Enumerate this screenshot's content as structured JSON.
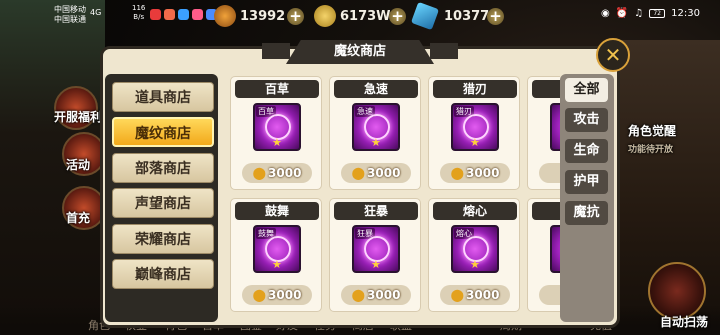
{
  "status_bar": {
    "carrier1": "中国移动",
    "carrier2": "中国联通",
    "network": "4G",
    "speed_value": "116",
    "speed_unit": "B/s",
    "battery": "72",
    "time": "12:30"
  },
  "currencies": [
    {
      "name": "energy",
      "value": "13992"
    },
    {
      "name": "gold",
      "value": "6173W"
    },
    {
      "name": "crystal",
      "value": "10377"
    }
  ],
  "background": {
    "left_items": [
      "开服福利",
      "活动",
      "首充"
    ],
    "right_items": [
      "角色觉醒",
      "功能待开放"
    ],
    "bottom_items": [
      "角色",
      "秩业",
      "背包",
      "百草",
      "图鉴",
      "好友",
      "任务",
      "商店",
      "联盟",
      "周期",
      "充值"
    ],
    "auto_sweep": "自动扫荡"
  },
  "shop": {
    "title": "魔纹商店",
    "nav": [
      "道具商店",
      "魔纹商店",
      "部落商店",
      "声望商店",
      "荣耀商店",
      "巅峰商店"
    ],
    "active_nav": "魔纹商店",
    "filters": [
      "全部",
      "攻击",
      "生命",
      "护甲",
      "魔抗"
    ],
    "active_filter": "全部",
    "items": [
      {
        "name": "百草",
        "tag": "百草",
        "price": "3000"
      },
      {
        "name": "急速",
        "tag": "急速",
        "price": "3000"
      },
      {
        "name": "猎刃",
        "tag": "猎刃",
        "price": "3000"
      },
      {
        "name": "鼓舞",
        "tag": "鼓舞",
        "price": "3000"
      },
      {
        "name": "狂暴",
        "tag": "狂暴",
        "price": "3000"
      },
      {
        "name": "熔心",
        "tag": "熔心",
        "price": "3000"
      }
    ]
  },
  "colors": {
    "panel_bg": "#efe6cf",
    "active_nav": "#f2a91b",
    "icon_purple": "#9a1fb8"
  }
}
